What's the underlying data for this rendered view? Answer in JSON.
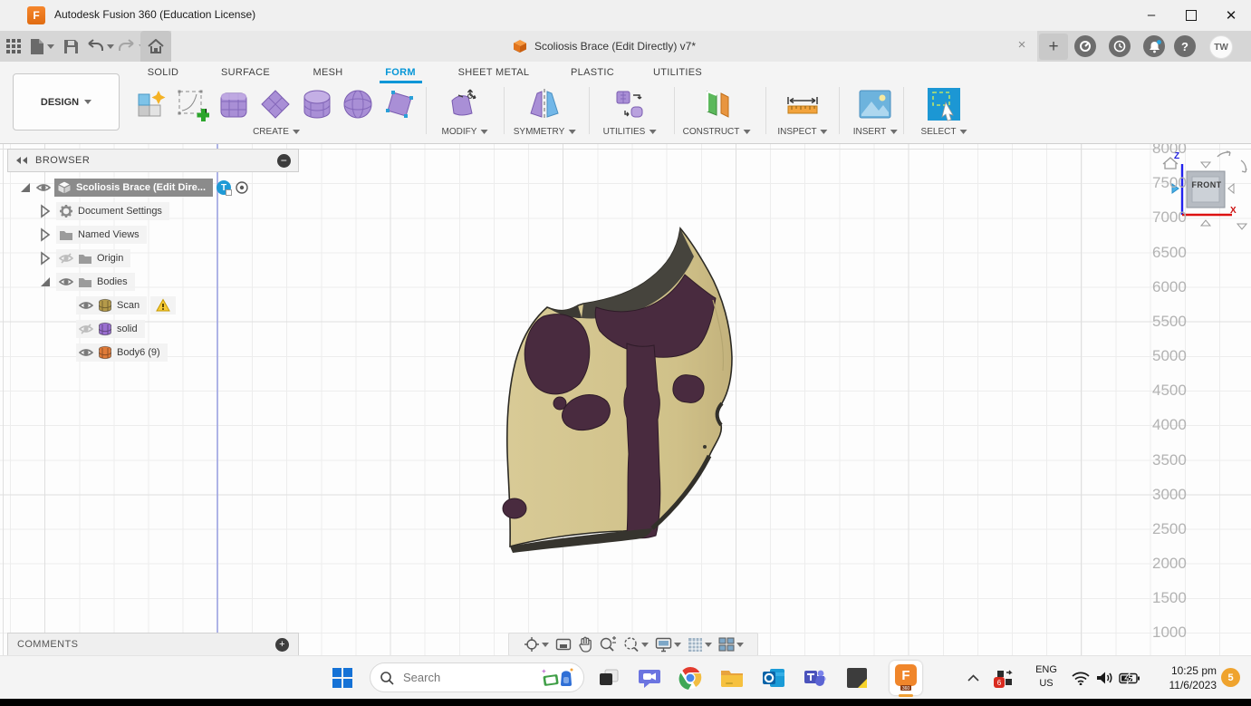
{
  "window": {
    "title": "Autodesk Fusion 360 (Education License)",
    "minimize": "–",
    "close": "✕"
  },
  "appbar": {
    "doc_tab_title": "Scoliosis Brace (Edit Directly) v7*",
    "doc_tab_close": "×",
    "new_tab": "+",
    "help": "?",
    "avatar": "TW"
  },
  "ribbon": {
    "design_button": "DESIGN",
    "tabs": [
      "SOLID",
      "SURFACE",
      "MESH",
      "FORM",
      "SHEET METAL",
      "PLASTIC",
      "UTILITIES"
    ],
    "active_tab": "FORM",
    "groups": [
      "CREATE",
      "MODIFY",
      "SYMMETRY",
      "UTILITIES",
      "CONSTRUCT",
      "INSPECT",
      "INSERT",
      "SELECT"
    ]
  },
  "browser": {
    "header": "BROWSER",
    "header_collapse": "−",
    "root_label": "Scoliosis Brace (Edit Dire...",
    "root_badge": "T",
    "items": [
      "Document Settings",
      "Named Views",
      "Origin",
      "Bodies"
    ],
    "bodies": [
      "Scan",
      "solid",
      "Body6 (9)"
    ]
  },
  "viewport": {
    "ruler_values": [
      "8000",
      "7500",
      "7000",
      "6500",
      "6000",
      "5500",
      "5000",
      "4500",
      "4000",
      "3500",
      "3000",
      "2500",
      "2000",
      "1500",
      "1000"
    ],
    "viewcube_face": "FRONT",
    "axis_z": "Z",
    "axis_x": "X"
  },
  "comments_label": "COMMENTS",
  "comments_add": "+",
  "taskbar": {
    "search_placeholder": "Search",
    "language_1": "ENG",
    "language_2": "US",
    "time": "10:25 pm",
    "date": "11/6/2023",
    "notification_count": "5",
    "sync_badge": "6",
    "fusion_badge": "360"
  },
  "colors": {
    "accent_blue": "#0696d7",
    "selection_gray": "#8b8b8b",
    "warning_yellow": "#f2c230",
    "brace_tan": "#d3c48e",
    "brace_purple": "#492b3f",
    "badge_orange": "#efa32e",
    "badge_red": "#d92b1f"
  }
}
